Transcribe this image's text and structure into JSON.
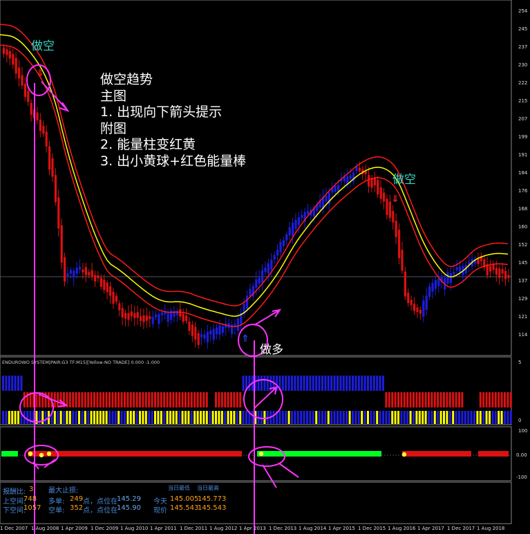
{
  "note": {
    "lines": [
      "做空趋势",
      "主图",
      "1. 出现向下箭头提示",
      "附图",
      "2. 能量柱变红黄",
      "3. 出小黄球+红色能量棒"
    ]
  },
  "labels": {
    "short_top": "做空",
    "short_right": "做空",
    "long_mid": "做多"
  },
  "price_axis": [
    "254",
    "245",
    "237",
    "230",
    "222",
    "215",
    "207",
    "199",
    "191",
    "184",
    "176",
    "168",
    "160",
    "152",
    "145",
    "137",
    "129",
    "121",
    "114"
  ],
  "indicator1": {
    "title": "ENDUROWO SYSTEM|PAIR:G3 TF:M15|[Yellow-NO TRADE] 0.000 -1.000",
    "axis": [
      "5",
      "0"
    ]
  },
  "indicator2": {
    "axis": [
      "100",
      "0.00",
      "-100"
    ]
  },
  "dates": [
    "1 Dec 2007",
    "1 Aug 2008",
    "1 Apr 2009",
    "1 Dec 2009",
    "1 Aug 2010",
    "1 Apr 2011",
    "1 Dec 2011",
    "1 Aug 2012",
    "1 Apr 2013",
    "1 Dec 2013",
    "1 Aug 2014",
    "1 Apr 2015",
    "1 Dec 2015",
    "1 Aug 2016",
    "1 Apr 2017",
    "1 Dec 2017",
    "1 Aug 2018"
  ],
  "stats": {
    "ratio_label": "报酬比:",
    "ratio_value": "3",
    "max_stop_label": "最大止损:",
    "long_pos_label": "上空间:",
    "long_pos_value": "748",
    "short_pos_label": "下空间:",
    "short_pos_value": "1057",
    "buy_label": "多单:",
    "buy_pts": "249",
    "buy_mid": "点，点位在",
    "buy_price": "145.29",
    "sell_label": "空单:",
    "sell_pts": "352",
    "sell_mid": "点，点位在",
    "sell_price": "145.90",
    "today_low_label": "当日最低",
    "today_high_label": "当日最高",
    "today_label": "今天",
    "today_low": "145.005",
    "today_high": "145.773",
    "now_label": "现价",
    "now_a": "145.543",
    "now_b": "145.543"
  },
  "colors": {
    "bull": "#1d1ddd",
    "bear": "#dd1111",
    "mid_line": "#ffff00",
    "band": "#ff1a1a",
    "annotation": "#ff33ff",
    "green_bar": "#00ff22"
  }
}
